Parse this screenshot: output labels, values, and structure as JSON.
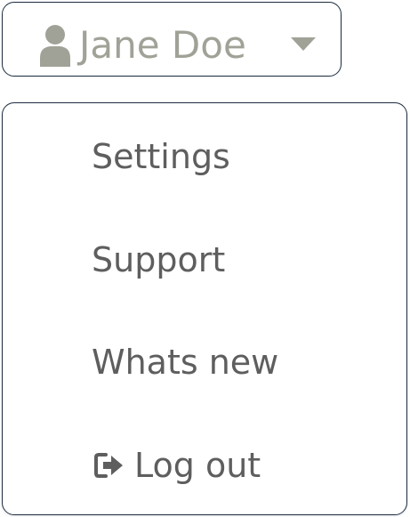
{
  "user_menu": {
    "user_name": "Jane Doe",
    "user_icon": "user-icon",
    "caret_icon": "caret-down-icon",
    "colors": {
      "border": "#1e2e40",
      "name_text": "#a0a297",
      "icon": "#a0a297",
      "menu_text": "#5e5e5e"
    }
  },
  "dropdown": {
    "items": [
      {
        "label": "Settings"
      },
      {
        "label": "Support"
      },
      {
        "label": "Whats new"
      },
      {
        "label": "Log out",
        "icon": "logout-icon"
      }
    ]
  }
}
